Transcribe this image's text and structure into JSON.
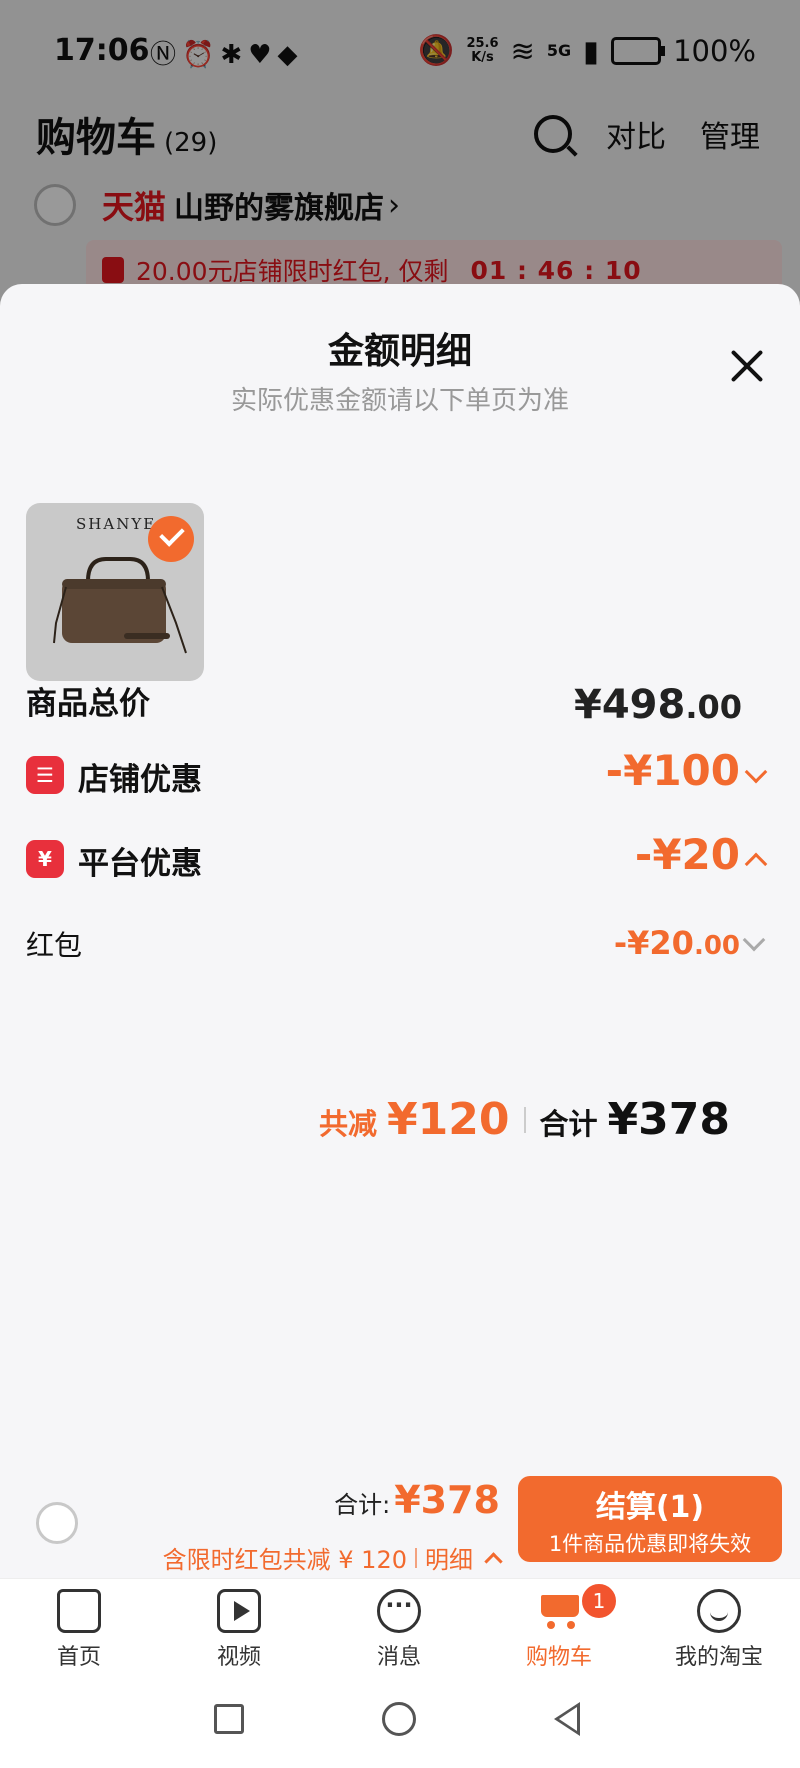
{
  "status_bar": {
    "time": "17:06",
    "icons": [
      "nfc-icon",
      "alarm-icon",
      "bluetooth-icon",
      "heartbeat-icon",
      "app-icon"
    ],
    "net_speed_top": "25.6",
    "net_speed_bottom": "K/s",
    "signal": "5G",
    "battery": "100%"
  },
  "background_page": {
    "title": "购物车",
    "count": "(29)",
    "compare_label": "对比",
    "manage_label": "管理",
    "store_tag": "天猫",
    "store_name": "山野的雾旗舰店",
    "store_arrow": "›",
    "promo_text": "20.00元店铺限时红包, 仅剩",
    "countdown": "01 : 46 : 10"
  },
  "sheet": {
    "title": "金额明细",
    "subtitle": "实际优惠金额请以下单页为准",
    "product_brand": "SHANYE",
    "rows": {
      "total_label": "商品总价",
      "total_value_main": "¥498",
      "total_value_dec": ".00",
      "store_discount_label": "店铺优惠",
      "store_discount_value": "-¥100",
      "store_icon_glyph": "☰",
      "platform_discount_label": "平台优惠",
      "platform_discount_value": "-¥20",
      "platform_icon_glyph": "¥",
      "redpack_label": "红包",
      "redpack_value_main": "-¥20",
      "redpack_value_dec": ".00"
    },
    "summary": {
      "save_label": "共减",
      "save_amount": "¥120",
      "sum_label": "合计",
      "sum_amount": "¥378"
    }
  },
  "checkout": {
    "total_label": "合计:",
    "total_amount": "¥378",
    "note": "含限时红包共减 ¥ 120",
    "detail_label": "明细",
    "button_label": "结算(1)",
    "button_sub": "1件商品优惠即将失效"
  },
  "tabs": [
    {
      "label": "首页"
    },
    {
      "label": "视频"
    },
    {
      "label": "消息"
    },
    {
      "label": "购物车"
    },
    {
      "label": "我的淘宝"
    }
  ],
  "cart_badge": "1",
  "colors": {
    "accent": "#f26a2e",
    "tmall_red": "#e4161f",
    "icon_red": "#e8303c"
  }
}
